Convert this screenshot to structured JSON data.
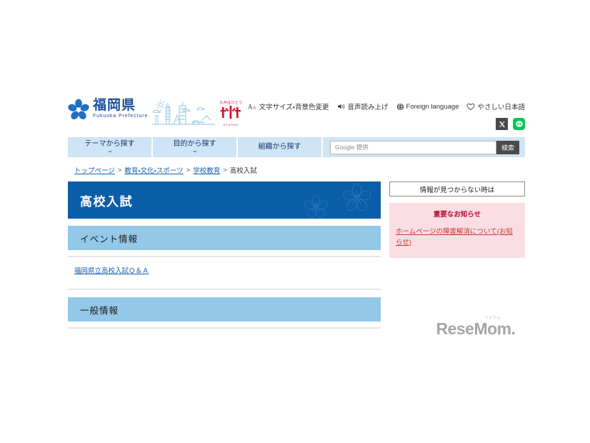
{
  "site": {
    "logo_jp": "福岡県",
    "logo_en": "Fukuoka Prefecture",
    "kyushu_top": "九州はひとつ",
    "kyushu_bottom": "KYUSHU"
  },
  "utility": {
    "items": [
      {
        "icon": "font-size-icon",
        "label": "文字サイズ・背景色変更"
      },
      {
        "icon": "speaker-icon",
        "label": "音声読み上げ"
      },
      {
        "icon": "globe-icon",
        "label": "Foreign language"
      },
      {
        "icon": "heart-icon",
        "label": "やさしい日本語"
      }
    ],
    "social": [
      {
        "icon": "x-icon",
        "label": "X"
      },
      {
        "icon": "line-icon",
        "label": "LINE"
      }
    ]
  },
  "nav": {
    "tabs": [
      {
        "label": "テーマから探す",
        "chevron": "⌄"
      },
      {
        "label": "目的から探す",
        "chevron": "⌄"
      },
      {
        "label": "組織から探す",
        "chevron": ""
      }
    ]
  },
  "search": {
    "placeholder": "Google 提供",
    "value": "",
    "button_label": "検索"
  },
  "breadcrumb": {
    "items": [
      {
        "label": "トップページ",
        "link": true
      },
      {
        "label": "教育・文化・スポーツ",
        "link": true
      },
      {
        "label": "学校教育",
        "link": true
      },
      {
        "label": "高校入試",
        "link": false
      }
    ],
    "separator": ">"
  },
  "main": {
    "page_title": "高校入試",
    "sections": [
      {
        "heading": "イベント情報"
      },
      {
        "heading": "一般情報"
      }
    ],
    "event_links": [
      {
        "label": "福岡県立高校入試Ｑ＆Ａ"
      }
    ]
  },
  "sidebar": {
    "help_button": "情報が見つからない時は",
    "notice_title": "重要なお知らせ",
    "notice_links": [
      {
        "label": "ホームページの障害解消について(お知らせ)"
      }
    ]
  },
  "watermark": {
    "ruby": "リセマム",
    "text": "ReseMom."
  },
  "colors": {
    "banner_blue": "#0b5ea8",
    "section_blue": "#93c8e8",
    "nav_blue": "#cfe4f4",
    "notice_pink": "#fadee4",
    "notice_red": "#b01030",
    "link_blue": "#1a5fa8",
    "line_green": "#06c755"
  }
}
